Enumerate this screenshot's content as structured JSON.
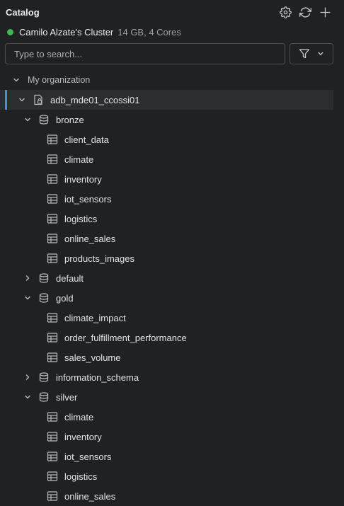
{
  "header": {
    "title": "Catalog"
  },
  "cluster": {
    "name": "Camilo Alzate's Cluster",
    "meta": "14 GB, 4 Cores",
    "status_color": "#3fb950"
  },
  "search": {
    "placeholder": "Type to search...",
    "value": ""
  },
  "tree": {
    "org": {
      "label": "My organization",
      "expanded": true
    },
    "catalog": {
      "label": "adb_mde01_ccossi01",
      "expanded": true,
      "selected": true
    },
    "bronze": {
      "label": "bronze",
      "expanded": true,
      "tables": [
        "client_data",
        "climate",
        "inventory",
        "iot_sensors",
        "logistics",
        "online_sales",
        "products_images"
      ]
    },
    "default": {
      "label": "default",
      "expanded": false
    },
    "gold": {
      "label": "gold",
      "expanded": true,
      "tables": [
        "climate_impact",
        "order_fulfillment_performance",
        "sales_volume"
      ]
    },
    "information_schema": {
      "label": "information_schema",
      "expanded": false
    },
    "silver": {
      "label": "silver",
      "expanded": true,
      "tables": [
        "climate",
        "inventory",
        "iot_sensors",
        "logistics",
        "online_sales"
      ]
    }
  },
  "icons": {
    "settings": "gear-icon",
    "refresh": "refresh-icon",
    "add": "plus-icon",
    "filter": "filter-icon",
    "schema": "database-icon",
    "table": "table-icon",
    "catalog": "catalog-icon"
  },
  "colors": {
    "background": "#1f2123",
    "selection": "#2b2e31",
    "accent": "#4c8fd6"
  }
}
